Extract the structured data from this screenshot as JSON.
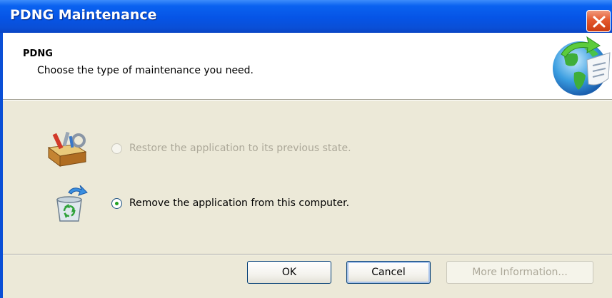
{
  "window": {
    "title": "PDNG Maintenance",
    "close_icon": "close-icon"
  },
  "header": {
    "title": "PDNG",
    "subtitle": "Choose the type of maintenance you need.",
    "logo_icon": "globe-refresh-icon"
  },
  "options": [
    {
      "label": "Restore the application to its previous state.",
      "icon": "toolbox-icon",
      "selected": false,
      "enabled": false
    },
    {
      "label": "Remove the application from this computer.",
      "icon": "recycle-bin-icon",
      "selected": true,
      "enabled": true
    }
  ],
  "buttons": {
    "ok": "OK",
    "cancel": "Cancel",
    "more_info": "More Information..."
  },
  "colors": {
    "titlebar": "#0a4fd6",
    "panel": "#ece9d8",
    "close": "#e4582e",
    "radio_dot": "#21a121"
  }
}
